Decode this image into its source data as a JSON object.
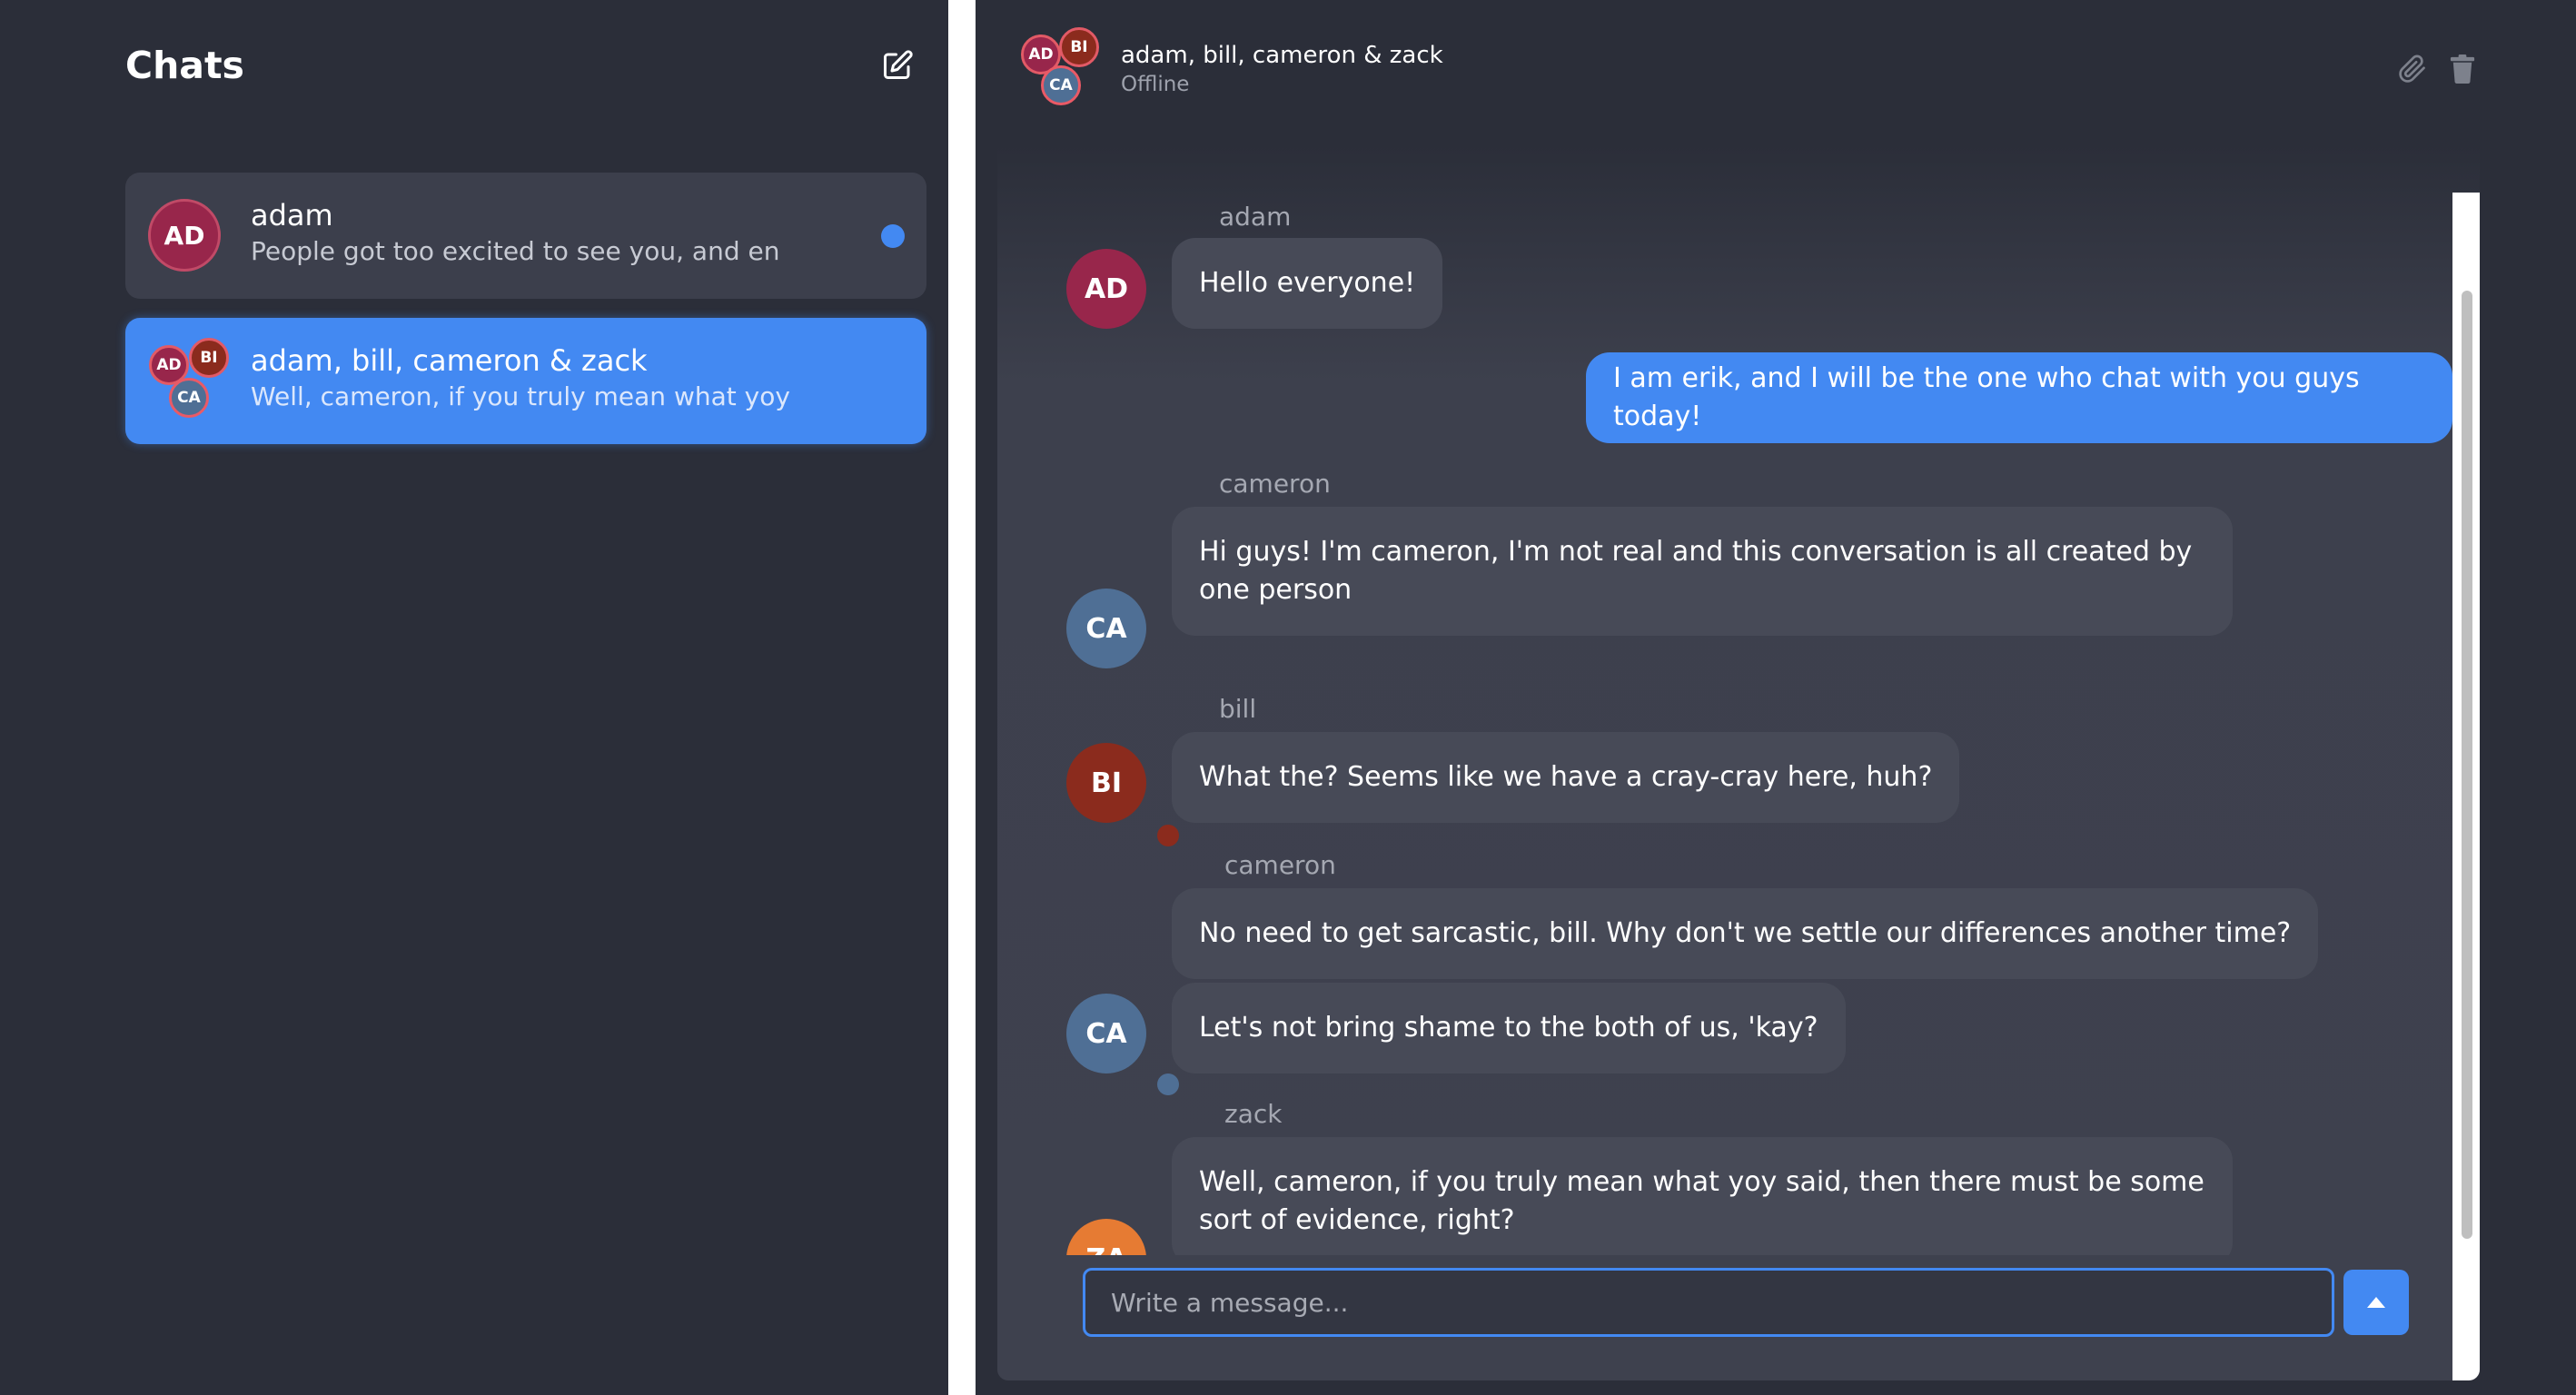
{
  "sidebar": {
    "title": "Chats",
    "compose_icon": "edit-square-icon",
    "chats": [
      {
        "name": "adam",
        "preview": "People got too excited to see you, and en",
        "avatars": [
          "AD"
        ],
        "unread": true,
        "selected": false
      },
      {
        "name": "adam, bill, cameron & zack",
        "preview": "Well, cameron, if you truly mean what yoy",
        "avatars": [
          "AD",
          "BI",
          "CA"
        ],
        "unread": false,
        "selected": true
      }
    ]
  },
  "header": {
    "avatars": [
      "AD",
      "BI",
      "CA"
    ],
    "title": "adam, bill, cameron & zack",
    "status": "Offline",
    "attach_icon": "paperclip-icon",
    "delete_icon": "trash-icon"
  },
  "messages": [
    {
      "sender": "adam",
      "initials": "AD",
      "text": "Hello everyone!"
    },
    {
      "sender": "erik",
      "mine": true,
      "text": "I am erik, and I will be the one who chat with you guys today!"
    },
    {
      "sender": "cameron",
      "initials": "CA",
      "text": "Hi guys! I'm cameron, I'm not real and this conversation is all created by one person"
    },
    {
      "sender": "bill",
      "initials": "BI",
      "text": "What the? Seems like we have a cray-cray here, huh?"
    },
    {
      "sender": "cameron",
      "initials": "CA",
      "text": "No need to get sarcastic, bill. Why don't we settle our differences another time?"
    },
    {
      "sender": "cameron",
      "initials": "CA",
      "text": "Let's not bring shame to the both of us, 'kay?"
    },
    {
      "sender": "zack",
      "initials": "ZA",
      "text": "Well, cameron, if you truly mean what yoy said, then there must be some sort of evidence, right?"
    }
  ],
  "composer": {
    "placeholder": "Write a message...",
    "value": "",
    "send_icon": "arrow-up-icon"
  },
  "colors": {
    "accent": "#4389f2",
    "background": "#2b2e39",
    "bubble": "#474a57",
    "avatar_ad": "#98264b",
    "avatar_bi": "#8b2b1d",
    "avatar_ca": "#4f6f95",
    "avatar_za": "#e67b33"
  }
}
